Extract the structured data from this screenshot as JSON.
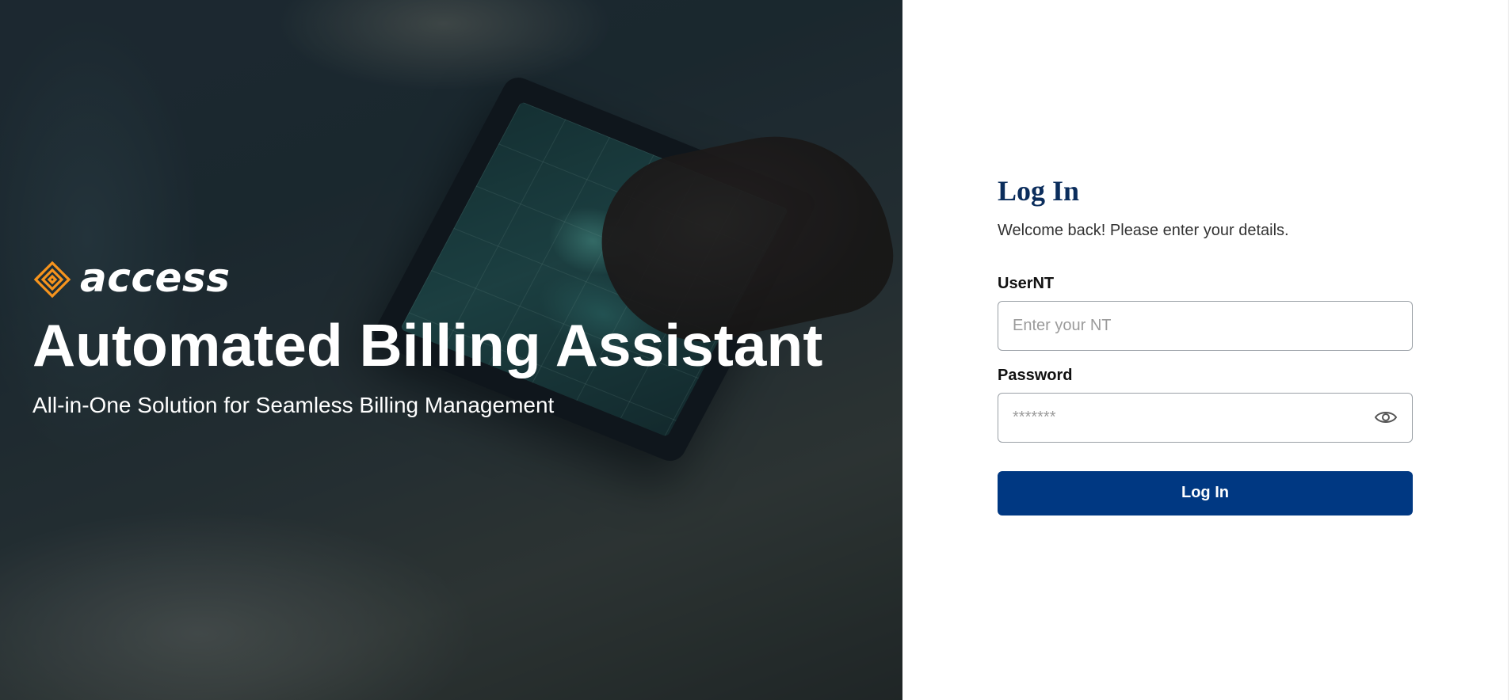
{
  "hero": {
    "brand_name": "access",
    "title": "Automated Billing Assistant",
    "subtitle": "All-in-One Solution for Seamless Billing Management"
  },
  "login": {
    "title": "Log In",
    "subtitle": "Welcome back! Please enter your details.",
    "user_label": "UserNT",
    "user_placeholder": "Enter your NT",
    "password_label": "Password",
    "password_placeholder": "*******",
    "submit_label": "Log In"
  },
  "icons": {
    "brand_mark": "access-diamond-logo-icon",
    "password_toggle": "eye-icon"
  },
  "colors": {
    "brand_orange": "#f7941d",
    "primary_blue": "#003882",
    "title_navy": "#0b2d5c"
  }
}
